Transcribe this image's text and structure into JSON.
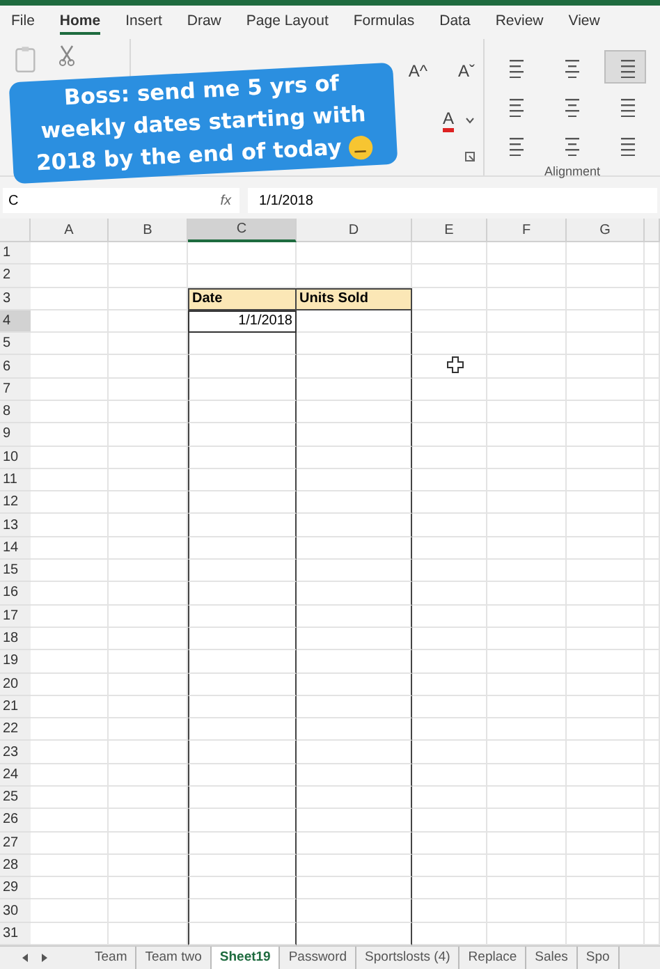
{
  "menu_tabs": [
    {
      "label": "File",
      "selected": false
    },
    {
      "label": "Home",
      "selected": true
    },
    {
      "label": "Insert",
      "selected": false
    },
    {
      "label": "Draw",
      "selected": false
    },
    {
      "label": "Page Layout",
      "selected": false
    },
    {
      "label": "Formulas",
      "selected": false
    },
    {
      "label": "Data",
      "selected": false
    },
    {
      "label": "Review",
      "selected": false
    },
    {
      "label": "View",
      "selected": false
    }
  ],
  "ribbon": {
    "font_grow": "A^",
    "font_shrink": "Aˇ",
    "font_color": "A",
    "group_label": "Alignment",
    "align_buttons": [
      {
        "selected": false
      },
      {
        "selected": false
      },
      {
        "selected": true
      },
      {
        "selected": false
      },
      {
        "selected": false
      },
      {
        "selected": false
      },
      {
        "selected": false
      },
      {
        "selected": false
      },
      {
        "selected": false
      }
    ]
  },
  "formula_bar": {
    "name_box": "C",
    "fx": "fx",
    "value": "1/1/2018"
  },
  "columns": [
    {
      "label": "A",
      "selected": false
    },
    {
      "label": "B",
      "selected": false
    },
    {
      "label": "C",
      "selected": true
    },
    {
      "label": "D",
      "selected": false
    },
    {
      "label": "E",
      "selected": false
    },
    {
      "label": "F",
      "selected": false
    },
    {
      "label": "G",
      "selected": false
    }
  ],
  "rows": [
    {
      "label": "1",
      "selected": false
    },
    {
      "label": "2",
      "selected": false
    },
    {
      "label": "3",
      "selected": false
    },
    {
      "label": "4",
      "selected": true
    },
    {
      "label": "5",
      "selected": false
    },
    {
      "label": "6",
      "selected": false
    },
    {
      "label": "7",
      "selected": false
    },
    {
      "label": "8",
      "selected": false
    },
    {
      "label": "9",
      "selected": false
    },
    {
      "label": "10",
      "selected": false
    },
    {
      "label": "11",
      "selected": false
    },
    {
      "label": "12",
      "selected": false
    },
    {
      "label": "13",
      "selected": false
    },
    {
      "label": "14",
      "selected": false
    },
    {
      "label": "15",
      "selected": false
    },
    {
      "label": "16",
      "selected": false
    },
    {
      "label": "17",
      "selected": false
    },
    {
      "label": "18",
      "selected": false
    },
    {
      "label": "19",
      "selected": false
    },
    {
      "label": "20",
      "selected": false
    },
    {
      "label": "21",
      "selected": false
    },
    {
      "label": "22",
      "selected": false
    },
    {
      "label": "23",
      "selected": false
    },
    {
      "label": "24",
      "selected": false
    },
    {
      "label": "25",
      "selected": false
    },
    {
      "label": "26",
      "selected": false
    },
    {
      "label": "27",
      "selected": false
    },
    {
      "label": "28",
      "selected": false
    },
    {
      "label": "29",
      "selected": false
    },
    {
      "label": "30",
      "selected": false
    },
    {
      "label": "31",
      "selected": false
    }
  ],
  "table": {
    "headers": [
      "Date",
      "Units Sold"
    ],
    "values": [
      {
        "text": "1/1/2018",
        "selected": true
      }
    ]
  },
  "sheet_tabs": [
    {
      "label": "Team",
      "selected": false
    },
    {
      "label": "Team two",
      "selected": false
    },
    {
      "label": "Sheet19",
      "selected": true
    },
    {
      "label": "Password",
      "selected": false
    },
    {
      "label": "Sportslosts (4)",
      "selected": false
    },
    {
      "label": "Replace",
      "selected": false
    },
    {
      "label": "Sales",
      "selected": false
    },
    {
      "label": "Spo",
      "selected": false
    }
  ],
  "caption": {
    "lines": [
      "Boss: send me 5 yrs of",
      "weekly dates starting with",
      "2018 by the end of today"
    ]
  }
}
